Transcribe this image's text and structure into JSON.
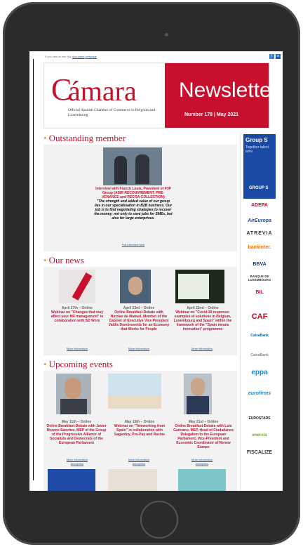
{
  "topbar": {
    "text_pre": "If you cannot see this ",
    "link1": "document",
    "link2": "webpage"
  },
  "header": {
    "logo_c": "C",
    "logo_word": "ámara",
    "logo_sub": "Official Spanish Chamber of Commerce in Belgium and Luxembourg",
    "title": "Newsletter",
    "issue": "Number 178 | May 2021"
  },
  "sections": {
    "outstanding": {
      "title": "Outstanding member",
      "caption_red": "Interview with Franck Louis, President of F3P Group (ASIR RECOUVREMENT, PRE-VENANCE and RECOA COLLECTION)",
      "caption_quote": "\"The strength and added value of our group lies in our specialisation in B2B business. Our job is to find negotiating strategies to recover the money; not only to save jobs for SMEs, but also for large enterprises.",
      "more": "Full interview here"
    },
    "news": {
      "title": "Our news",
      "items": [
        {
          "date": "April 27th – Online",
          "text": "Webinar on \"Changes that may affect your HR management\" in collaboration with SD Worx",
          "more": "More information"
        },
        {
          "date": "April 23rd – Online",
          "text": "Online Breakfast-Debate with Nicolas de Manuel, Member of the Cabinet of Executive Vice President Valdis Dombrovskis for an Economy that Works for People",
          "more": "More information"
        },
        {
          "date": "April 22nd – Online",
          "text": "Webinar on \"Covid-19 response: examples of solutions in Belgium, Luxembourg and Spain\" within the framework of the \"Spain means innovation\" programme",
          "more": "More information"
        }
      ]
    },
    "events": {
      "title": "Upcoming events",
      "items": [
        {
          "date": "May 11th – Online",
          "text": "Online Breakfast-Debate with Javier Moreno Sánchez, MEP of the Group of the Progressive Alliance of Socialists and Democrats of the European Parliament",
          "more": "More information",
          "reg": "Inscription"
        },
        {
          "date": "May 19th – Online",
          "text": "Webinar on \"Teleworking from Spain\" in collaboration with Sagardoy, Pro-Pay and Racine",
          "more": "More information",
          "reg": "Inscription"
        },
        {
          "date": "May 21st – Online",
          "text": "Online Breakfast-Debate with Luis Garicano, MEP, Head of Ciudadanos Delegation to the European Parliament, Vice-President and Economic Coordinator of Renew Europe",
          "more": "More information",
          "reg": "Inscription"
        }
      ]
    }
  },
  "sidebar": {
    "ad_lines": [
      "Group S",
      "Together talent",
      "wins"
    ],
    "ad_logo": "GROUP S",
    "sponsors": [
      "ADEPA",
      "AirEuropa",
      "ATREVIA",
      "bankinter.",
      "BBVA",
      "BANQUE DE LUXEMBOURG",
      "BIL",
      "CAF",
      "CaixaBank",
      "CaixaBank",
      "eppa",
      "eurofirms",
      "EUROSTARS",
      "enerxia",
      "FISCALIZE"
    ]
  },
  "colors": {
    "brand_red": "#c8102e",
    "accent_orange": "#f0a500",
    "link_blue": "#1a5ab0"
  }
}
